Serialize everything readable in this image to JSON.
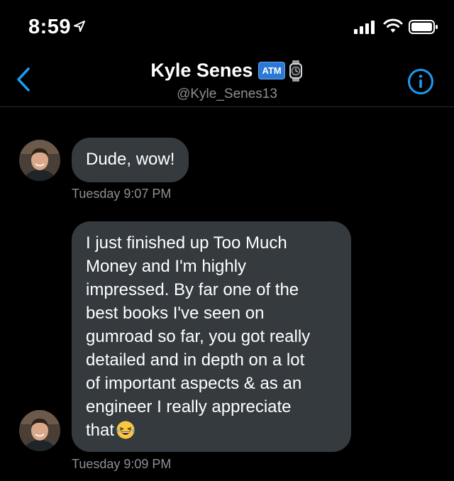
{
  "status_bar": {
    "time": "8:59",
    "icons": [
      "location-arrow-icon",
      "signal-icon",
      "wifi-icon",
      "battery-icon"
    ]
  },
  "header": {
    "name": "Kyle Senes",
    "badge": "ATM",
    "handle": "@Kyle_Senes13",
    "icons": [
      "back-chevron-icon",
      "watch-icon",
      "info-icon"
    ]
  },
  "colors": {
    "accent": "#1d9bf0",
    "bubble": "#353a3f",
    "secondary_text": "#8b8f94"
  },
  "messages": [
    {
      "text": "Dude, wow!",
      "timestamp": "Tuesday 9:07 PM"
    },
    {
      "text": "I just finished up Too Much\nMoney and I'm highly\nimpressed. By far one of the\nbest books I've seen on\ngumroad so far, you got really\ndetailed and in depth on a lot\nof important aspects & as an\nengineer I really appreciate\nthat",
      "emoji": "laughing-emoji",
      "timestamp": "Tuesday 9:09 PM"
    }
  ]
}
